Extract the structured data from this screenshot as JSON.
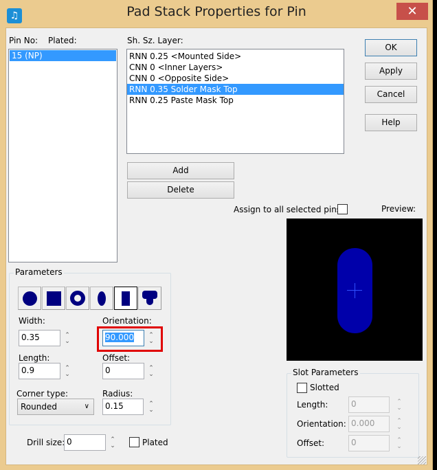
{
  "window": {
    "title": "Pad Stack Properties for Pin",
    "close_label": "✕",
    "icon": "app-icon"
  },
  "pin_list": {
    "header_pin": "Pin No:",
    "header_plated": "Plated:",
    "items": [
      "15 (NP)"
    ],
    "selected": 0
  },
  "layers": {
    "header": "Sh. Sz. Layer:",
    "items": [
      "RNN 0.25 <Mounted Side>",
      "CNN 0 <Inner Layers>",
      "CNN 0 <Opposite Side>",
      "RNN 0.35 Solder Mask Top",
      "RNN 0.25 Paste Mask Top"
    ],
    "selected": 3
  },
  "buttons": {
    "ok": "OK",
    "apply": "Apply",
    "cancel": "Cancel",
    "help": "Help",
    "add": "Add",
    "delete": "Delete"
  },
  "assign_all": {
    "label": "Assign to all selected pins",
    "checked": false
  },
  "preview": {
    "label": "Preview:",
    "pad_color": "#0000AA",
    "cross_color": "#3050FF"
  },
  "parameters": {
    "legend": "Parameters",
    "shapes": [
      "round",
      "square",
      "annulus",
      "oval",
      "rectangle",
      "thermal"
    ],
    "selected_shape": "rectangle",
    "width_label": "Width:",
    "width": "0.35",
    "orientation_label": "Orientation:",
    "orientation": "90.000",
    "length_label": "Length:",
    "length": "0.9",
    "offset_label": "Offset:",
    "offset": "0",
    "corner_label": "Corner type:",
    "corner": "Rounded",
    "radius_label": "Radius:",
    "radius": "0.15"
  },
  "drill": {
    "label": "Drill size:",
    "value": "0",
    "plated_label": "Plated",
    "plated": false
  },
  "slot": {
    "legend": "Slot Parameters",
    "slotted_label": "Slotted",
    "slotted": false,
    "length_label": "Length:",
    "length": "0",
    "orientation_label": "Orientation:",
    "orientation": "0.000",
    "offset_label": "Offset:",
    "offset": "0"
  },
  "highlight_color": "#E00000"
}
